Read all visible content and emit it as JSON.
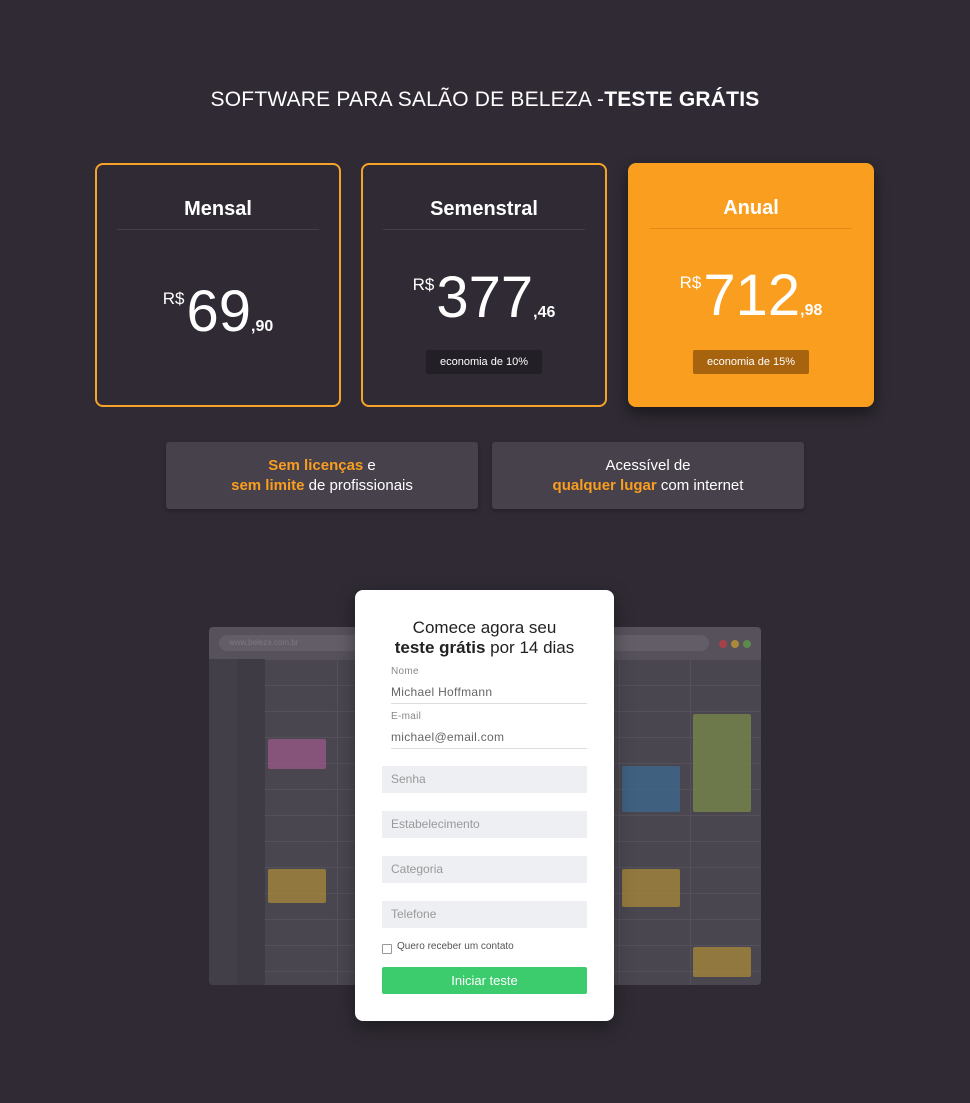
{
  "headline": {
    "regular": "SOFTWARE PARA SALÃO DE BELEZA -",
    "bold": "TESTE GRÁTIS"
  },
  "plans": [
    {
      "name": "Mensal",
      "currency": "R$",
      "integer": "69",
      "decimal": ",90",
      "badge": ""
    },
    {
      "name": "Semenstral",
      "currency": "R$",
      "integer": "377",
      "decimal": ",46",
      "badge": "economia de 10%"
    },
    {
      "name": "Anual",
      "currency": "R$",
      "integer": "712",
      "decimal": ",98",
      "badge": "economia de 15%"
    }
  ],
  "features": [
    {
      "hl1": "Sem licenças",
      "t1": " e",
      "hl2": "sem limite",
      "t2": " de profissionais"
    },
    {
      "t1": "Acessível de",
      "hl2": "qualquer lugar",
      "t2": " com internet"
    }
  ],
  "mockup": {
    "url": "www.beleza.com.br"
  },
  "form": {
    "title_line1": "Comece agora seu",
    "title_bold": "teste grátis",
    "title_rest": " por 14 dias",
    "name_label": "Nome",
    "name_value": "Michael Hoffmann",
    "email_label": "E-mail",
    "email_value": "michael@email.com",
    "password_placeholder": "Senha",
    "establishment_placeholder": "Estabelecimento",
    "category_placeholder": "Categoria",
    "phone_placeholder": "Telefone",
    "checkbox_label": "Quero receber um contato",
    "submit_label": "Iniciar teste"
  },
  "colors": {
    "background": "#2f2a33",
    "accent": "#f99e1f",
    "button": "#3ccc6e"
  }
}
